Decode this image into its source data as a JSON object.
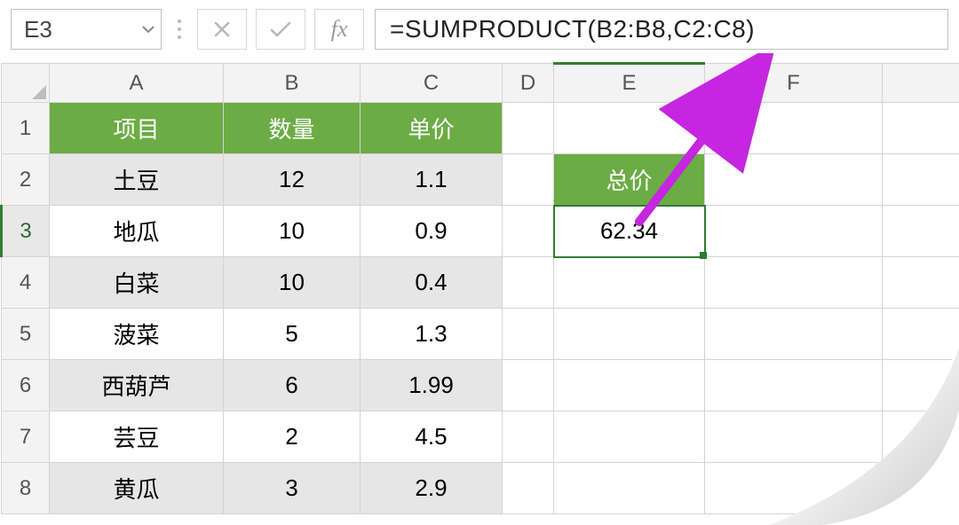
{
  "formula_bar": {
    "name_box": "E3",
    "fx_label": "fx",
    "formula": "=SUMPRODUCT(B2:B8,C2:C8)"
  },
  "columns": [
    "A",
    "B",
    "C",
    "D",
    "E",
    "F"
  ],
  "rows": [
    "1",
    "2",
    "3",
    "4",
    "5",
    "6",
    "7",
    "8"
  ],
  "selected": {
    "row": "3",
    "col": "E"
  },
  "headers_row1": {
    "A": "项目",
    "B": "数量",
    "C": "单价"
  },
  "summary": {
    "label_cell": "E2",
    "label": "总价",
    "value_cell": "E3",
    "value": "62.34"
  },
  "data_rows": [
    {
      "row": "2",
      "A": "土豆",
      "B": "12",
      "C": "1.1",
      "alt": true
    },
    {
      "row": "3",
      "A": "地瓜",
      "B": "10",
      "C": "0.9",
      "alt": false
    },
    {
      "row": "4",
      "A": "白菜",
      "B": "10",
      "C": "0.4",
      "alt": true
    },
    {
      "row": "5",
      "A": "菠菜",
      "B": "5",
      "C": "1.3",
      "alt": false
    },
    {
      "row": "6",
      "A": "西葫芦",
      "B": "6",
      "C": "1.99",
      "alt": true
    },
    {
      "row": "7",
      "A": "芸豆",
      "B": "2",
      "C": "4.5",
      "alt": false
    },
    {
      "row": "8",
      "A": "黄瓜",
      "B": "3",
      "C": "2.9",
      "alt": true
    }
  ],
  "colors": {
    "header_green": "#6bac44",
    "selection": "#2f7d32",
    "arrow": "#c626e0"
  }
}
